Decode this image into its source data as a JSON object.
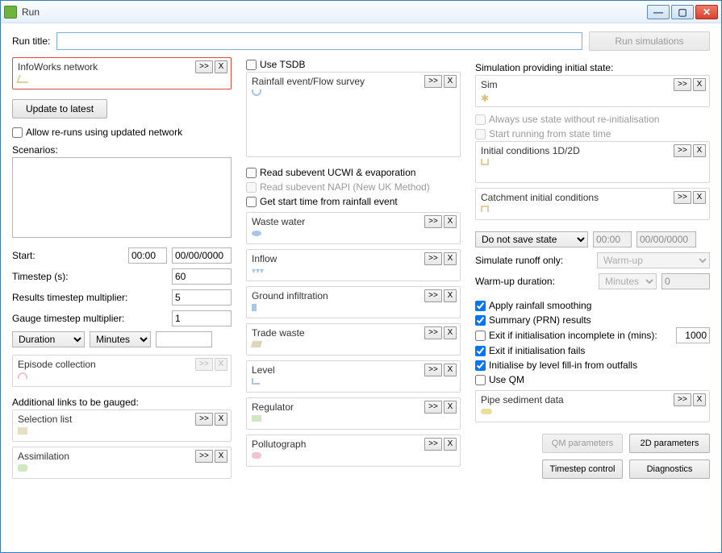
{
  "window": {
    "title": "Run"
  },
  "top": {
    "run_title_label": "Run title:",
    "run_title_value": "",
    "run_button": "Run simulations"
  },
  "col1": {
    "network_box": "InfoWorks network",
    "update_btn": "Update to latest",
    "allow_reruns": "Allow re-runs using updated network",
    "scenarios_label": "Scenarios:",
    "start_label": "Start:",
    "start_time": "00:00",
    "start_date": "00/00/0000",
    "timestep_label": "Timestep (s):",
    "timestep_value": "60",
    "results_mult_label": "Results timestep multiplier:",
    "results_mult_value": "5",
    "gauge_mult_label": "Gauge timestep multiplier:",
    "gauge_mult_value": "1",
    "duration_select": "Duration",
    "duration_unit": "Minutes",
    "duration_value": "",
    "episode_box": "Episode collection",
    "additional_links_label": "Additional links to be gauged:",
    "selection_list_box": "Selection list",
    "assimilation_box": "Assimilation"
  },
  "col2": {
    "use_tsdb": "Use TSDB",
    "rainfall_box": "Rainfall event/Flow survey",
    "read_ucwi": "Read subevent UCWI & evaporation",
    "read_napi": "Read subevent NAPI (New UK Method)",
    "get_start_time": "Get start time from rainfall event",
    "waste_water_box": "Waste water",
    "inflow_box": "Inflow",
    "ground_inf_box": "Ground infiltration",
    "trade_waste_box": "Trade waste",
    "level_box": "Level",
    "regulator_box": "Regulator",
    "pollutograph_box": "Pollutograph"
  },
  "col3": {
    "sim_provide_label": "Simulation providing initial state:",
    "sim_box": "Sim",
    "always_use_state": "Always use state without re-initialisation",
    "start_from_state_time": "Start running from state time",
    "initial_cond_box": "Initial conditions 1D/2D",
    "catchment_cond_box": "Catchment initial conditions",
    "save_state_select": "Do not save state",
    "save_time": "00:00",
    "save_date": "00/00/0000",
    "sim_runoff_label": "Simulate runoff only:",
    "sim_runoff_value": "Warm-up",
    "warmup_label": "Warm-up duration:",
    "warmup_unit": "Minutes",
    "warmup_value": "0",
    "apply_smoothing": "Apply rainfall smoothing",
    "summary_prn": "Summary (PRN) results",
    "exit_incomplete": "Exit if initialisation incomplete in (mins):",
    "exit_incomplete_value": "1000",
    "exit_fails": "Exit if initialisation fails",
    "init_level_fill": "Initialise by level fill-in from outfalls",
    "use_qm": "Use QM",
    "pipe_sediment_box": "Pipe sediment data",
    "qm_params_btn": "QM parameters",
    "params_2d_btn": "2D parameters",
    "timestep_ctl_btn": "Timestep control",
    "diagnostics_btn": "Diagnostics"
  },
  "misc": {
    "dd": ">>",
    "x": "X"
  }
}
